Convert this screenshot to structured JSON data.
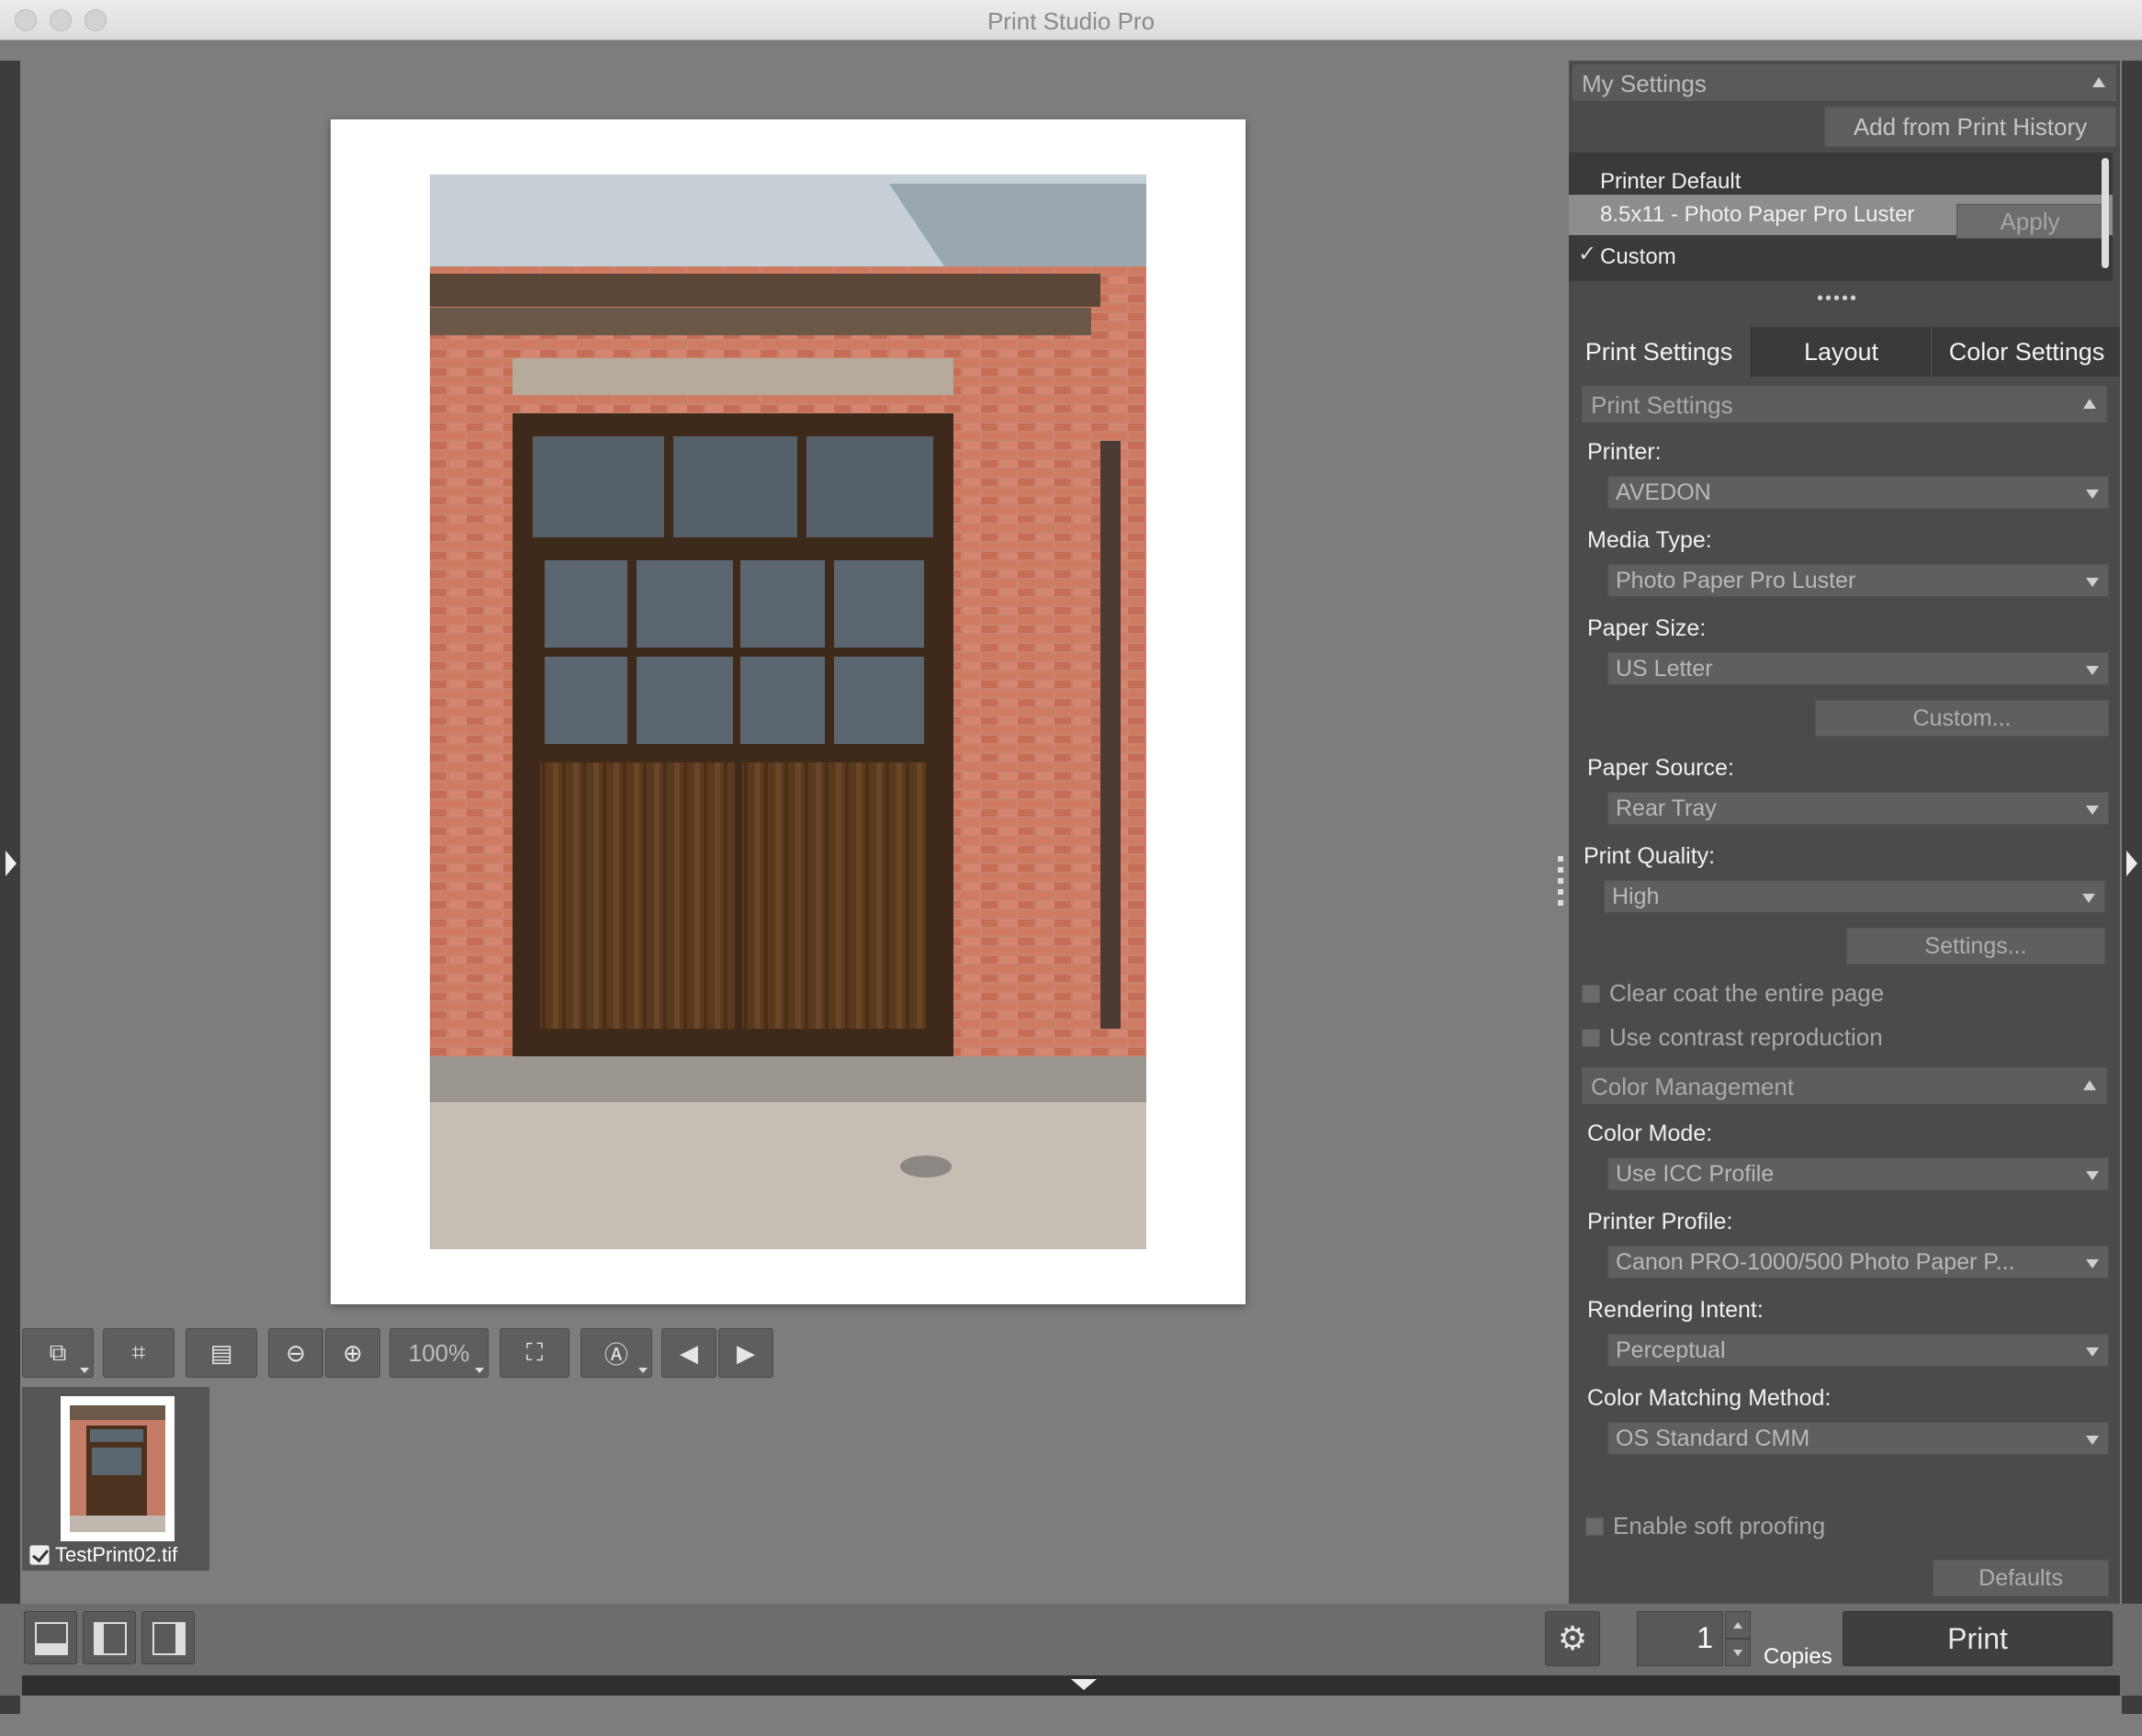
{
  "window": {
    "title": "Print Studio Pro"
  },
  "toolbar": {
    "zoom": "100%"
  },
  "thumbnail": {
    "filename": "TestPrint02.tif",
    "checked": true
  },
  "my_settings": {
    "header": "My Settings",
    "add_from_history": "Add from Print History",
    "items": [
      "Printer Default",
      "8.5x11 - Photo Paper Pro Luster",
      "Custom"
    ],
    "apply": "Apply"
  },
  "tabs": [
    "Print Settings",
    "Layout",
    "Color Settings"
  ],
  "print_settings": {
    "header": "Print Settings",
    "printer_label": "Printer:",
    "printer": "AVEDON",
    "media_label": "Media Type:",
    "media": "Photo Paper Pro Luster",
    "size_label": "Paper Size:",
    "size": "US Letter",
    "custom_btn": "Custom...",
    "source_label": "Paper Source:",
    "source": "Rear Tray",
    "quality_label": "Print Quality:",
    "quality": "High",
    "settings_btn": "Settings...",
    "clear_coat": "Clear coat the entire page",
    "contrast": "Use contrast reproduction"
  },
  "color_management": {
    "header": "Color Management",
    "mode_label": "Color Mode:",
    "mode": "Use ICC Profile",
    "profile_label": "Printer Profile:",
    "profile": "Canon PRO-1000/500 Photo Paper P...",
    "intent_label": "Rendering Intent:",
    "intent": "Perceptual",
    "cmm_label": "Color Matching Method:",
    "cmm": "OS Standard CMM",
    "soft_proof": "Enable soft proofing",
    "defaults_btn": "Defaults"
  },
  "bottom": {
    "copies_value": "1",
    "copies_label": "Copies",
    "print": "Print"
  }
}
